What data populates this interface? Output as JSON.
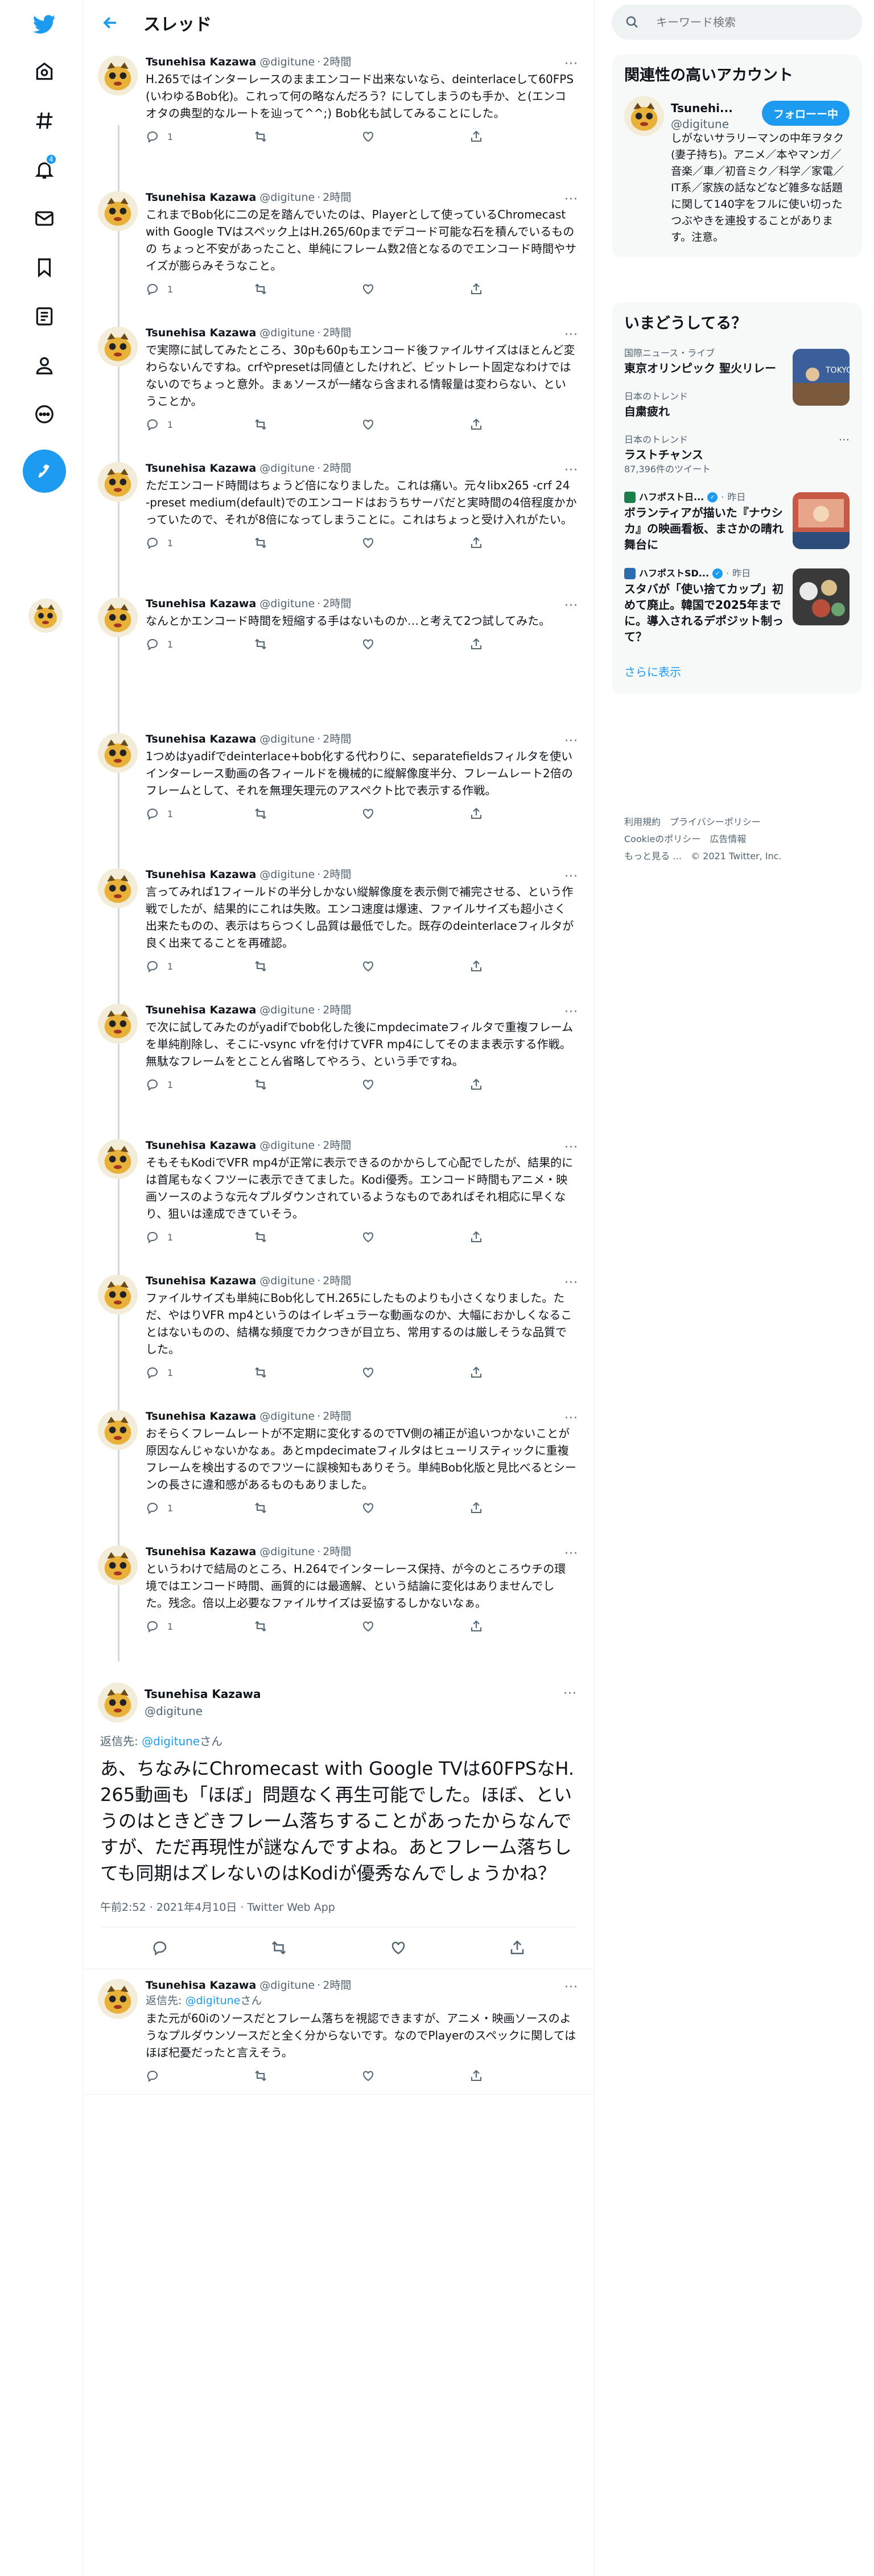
{
  "app": {
    "name": "Twitter"
  },
  "nav": {
    "notification_count": "4",
    "items": [
      "explore",
      "hashtag",
      "notifications",
      "messages",
      "bookmarks",
      "lists",
      "profile",
      "more"
    ]
  },
  "header": {
    "title": "スレッド"
  },
  "thread": [
    {
      "name": "Tsunehisa Kazawa",
      "handle": "@digitune",
      "time": "2時間",
      "text": "H.265ではインターレースのままエンコード出来ないなら、deinterlaceして60FPS(いわゆるBob化)。これって何の略なんだろう？にしてしまうのも手か、と(エンコオタの典型的なルートを辿って^^;) Bob化も試してみることにした。",
      "replies": "1"
    },
    {
      "name": "Tsunehisa Kazawa",
      "handle": "@digitune",
      "time": "2時間",
      "text": "これまでBob化に二の足を踏んでいたのは、Playerとして使っているChromecast with Google TVはスペック上はH.265/60pまでデコード可能な石を積んでいるものの ちょっと不安があったこと、単純にフレーム数2倍となるのでエンコード時間やサイズが膨らみそうなこと。",
      "replies": "1"
    },
    {
      "name": "Tsunehisa Kazawa",
      "handle": "@digitune",
      "time": "2時間",
      "text": "で実際に試してみたところ、30pも60pもエンコード後ファイルサイズはほとんど変わらないんですね。crfやpresetは同値としたけれど、ビットレート固定なわけではないのでちょっと意外。まぁソースが一緒なら含まれる情報量は変わらない、ということか。",
      "replies": "1"
    },
    {
      "name": "Tsunehisa Kazawa",
      "handle": "@digitune",
      "time": "2時間",
      "text": "ただエンコード時間はちょうど倍になりました。これは痛い。元々libx265 -crf 24 -preset medium(default)でのエンコードはおうちサーバだと実時間の4倍程度かかっていたので、それが8倍になってしまうことに。これはちょっと受け入れがたい。",
      "replies": "1"
    },
    {
      "name": "Tsunehisa Kazawa",
      "handle": "@digitune",
      "time": "2時間",
      "text": "なんとかエンコード時間を短縮する手はないものか…と考えて2つ試してみた。",
      "replies": "1"
    },
    {
      "name": "Tsunehisa Kazawa",
      "handle": "@digitune",
      "time": "2時間",
      "text": "1つめはyadifでdeinterlace+bob化する代わりに、separatefieldsフィルタを使いインターレース動画の各フィールドを機械的に縦解像度半分、フレームレート2倍のフレームとして、それを無理矢理元のアスペクト比で表示する作戦。",
      "replies": "1"
    },
    {
      "name": "Tsunehisa Kazawa",
      "handle": "@digitune",
      "time": "2時間",
      "text": "言ってみれば1フィールドの半分しかない縦解像度を表示側で補完させる、という作戦でしたが、結果的にこれは失敗。エンコ速度は爆速、ファイルサイズも超小さく出来たものの、表示はちらつくし品質は最低でした。既存のdeinterlaceフィルタが良く出来てることを再確認。",
      "replies": "1"
    },
    {
      "name": "Tsunehisa Kazawa",
      "handle": "@digitune",
      "time": "2時間",
      "text": "で次に試してみたのがyadifでbob化した後にmpdecimateフィルタで重複フレームを単純削除し、そこに-vsync vfrを付けてVFR mp4にしてそのまま表示する作戦。無駄なフレームをとことん省略してやろう、という手ですね。",
      "replies": "1"
    },
    {
      "name": "Tsunehisa Kazawa",
      "handle": "@digitune",
      "time": "2時間",
      "text": "そもそもKodiでVFR mp4が正常に表示できるのかからして心配でしたが、結果的には首尾もなくフツーに表示できてました。Kodi優秀。エンコード時間もアニメ・映画ソースのような元々プルダウンされているようなものであればそれ相応に早くなり、狙いは達成できていそう。",
      "replies": "1"
    },
    {
      "name": "Tsunehisa Kazawa",
      "handle": "@digitune",
      "time": "2時間",
      "text": "ファイルサイズも単純にBob化してH.265にしたものよりも小さくなりました。ただ、やはりVFR mp4というのはイレギュラーな動画なのか、大幅におかしくなることはないものの、結構な頻度でカクつきが目立ち、常用するのは厳しそうな品質でした。",
      "replies": "1"
    },
    {
      "name": "Tsunehisa Kazawa",
      "handle": "@digitune",
      "time": "2時間",
      "text": "おそらくフレームレートが不定期に変化するのでTV側の補正が追いつかないことが原因なんじゃないかなぁ。あとmpdecimateフィルタはヒューリスティックに重複フレームを検出するのでフツーに誤検知もありそう。単純Bob化版と見比べるとシーンの長さに違和感があるものもありました。",
      "replies": "1"
    },
    {
      "name": "Tsunehisa Kazawa",
      "handle": "@digitune",
      "time": "2時間",
      "text": "というわけで結局のところ、H.264でインターレース保持、が今のところウチの環境ではエンコード時間、画質的には最適解、という結論に変化はありませんでした。残念。倍以上必要なファイルサイズは妥協するしかないなぁ。",
      "replies": "1"
    }
  ],
  "focus": {
    "name": "Tsunehisa Kazawa",
    "handle": "@digitune",
    "replying_prefix": "返信先: ",
    "replying_to": "@digitune",
    "replying_suffix": "さん",
    "text": "あ、ちなみにChromecast with Google TVは60FPSなH.265動画も「ほぼ」問題なく再生可能でした。ほぼ、というのはときどきフレーム落ちすることがあったからなんですが、ただ再現性が謎なんですよね。あとフレーム落ちしても同期はズレないのはKodiが優秀なんでしょうかね？",
    "meta": "午前2:52 · 2021年4月10日 · Twitter Web App"
  },
  "reply": {
    "name": "Tsunehisa Kazawa",
    "handle": "@digitune",
    "time": "2時間",
    "replying_prefix": "返信先: ",
    "replying_to": "@digitune",
    "replying_suffix": "さん",
    "text": "また元が60iのソースだとフレーム落ちを視認できますが、アニメ・映画ソースのようなプルダウンソースだと全く分からないです。なのでPlayerのスペックに関してはほぼ杞憂だったと言えそう。"
  },
  "search": {
    "placeholder": "キーワード検索"
  },
  "related": {
    "title": "関連性の高いアカウント",
    "name": "Tsunehi...",
    "handle": "@digitune",
    "follow_label": "フォローー中",
    "bio": "しがないサラリーマンの中年ヲタク(妻子持ち)。アニメ／本やマンガ／音楽／車／初音ミク／科学／家電／IT系／家族の話などなど雑多な話題に関して140字をフルに使い切ったつぶやきを連投することがあります。注意。"
  },
  "trends": {
    "title": "いまどうしてる？",
    "items": [
      {
        "category": "国際ニュース・ライブ",
        "name": "東京オリンピック 聖火リレー",
        "count": "",
        "thumb_text": "TOKYO"
      },
      {
        "category": "日本のトレンド",
        "name": "自粛疲れ",
        "count": ""
      },
      {
        "category": "日本のトレンド",
        "name": "ラストチャンス",
        "count": "87,396件のツイート"
      }
    ],
    "news": [
      {
        "source": "ハフポスト日...",
        "time": "昨日",
        "headline": "ボランティアが描いた『ナウシカ』の映画看板、まさかの晴れ舞台に"
      },
      {
        "source": "ハフポストSD...",
        "time": "昨日",
        "headline": "スタバが「使い捨てカップ」初めて廃止。韓国で2025年までに。導入されるデポジット制って？"
      }
    ],
    "show_more": "さらに表示"
  },
  "footer": {
    "links": [
      "利用規約",
      "プライバシーポリシー",
      "Cookieのポリシー",
      "広告情報",
      "もっと見る …"
    ],
    "copyright": "© 2021 Twitter, Inc."
  },
  "colors": {
    "accent": "#1d9bf0",
    "text": "#0f1419",
    "muted": "#536471"
  }
}
